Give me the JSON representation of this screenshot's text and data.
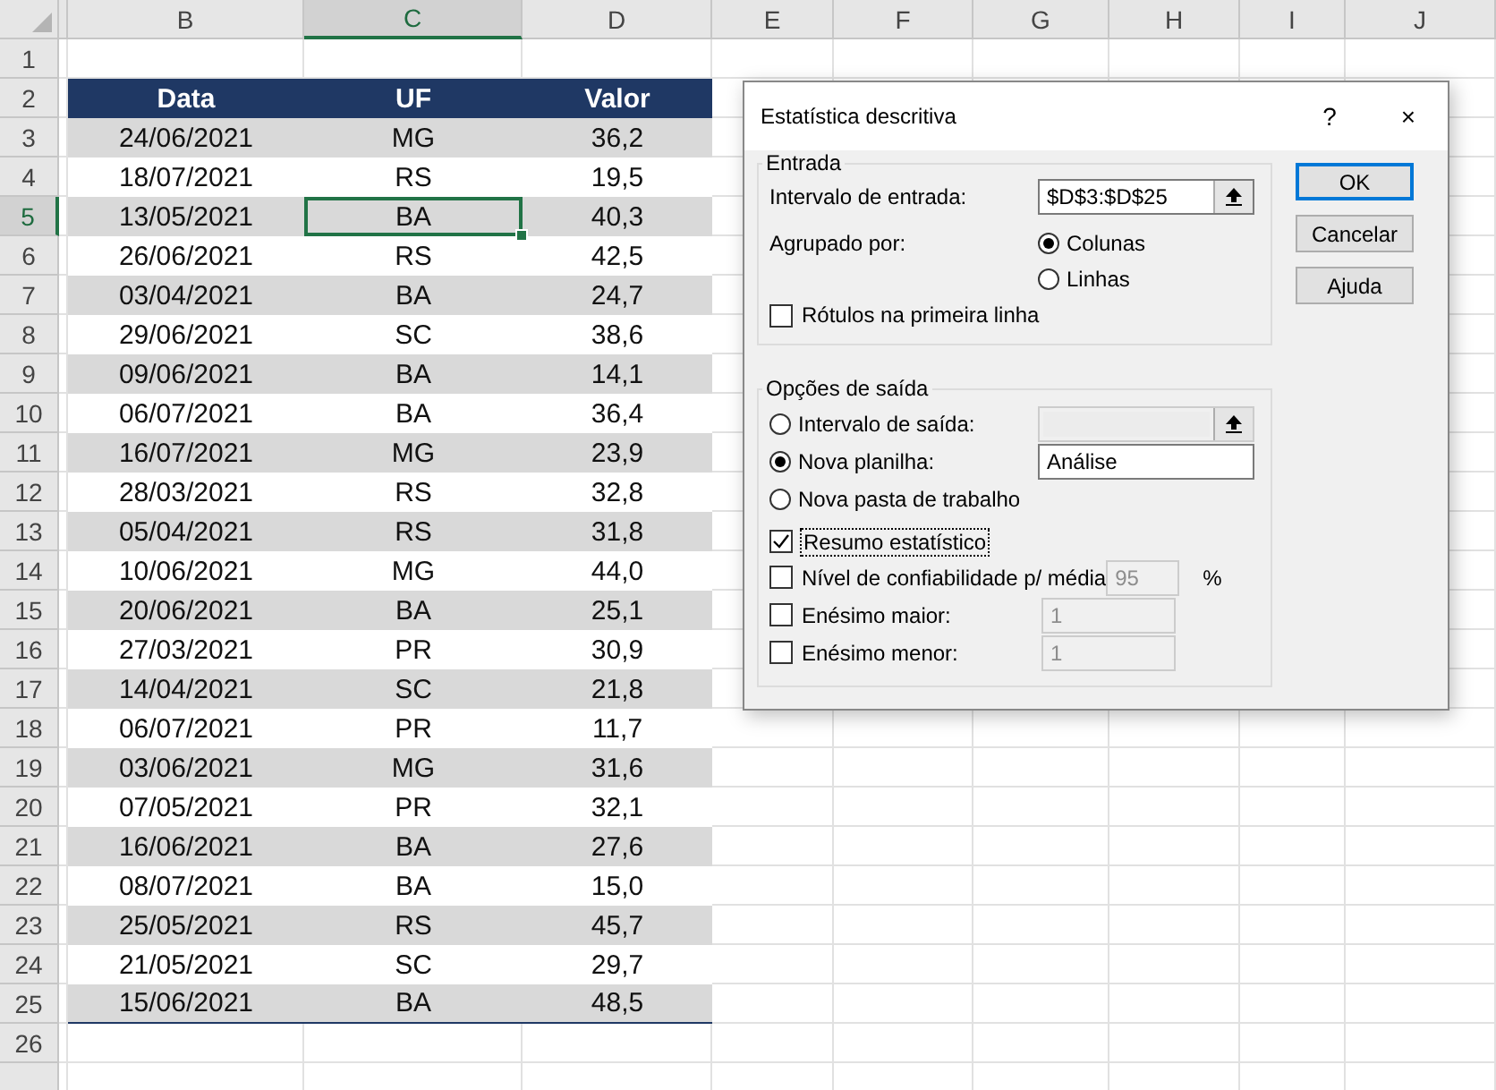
{
  "sheet": {
    "columns": [
      {
        "label": "B",
        "selected": false
      },
      {
        "label": "C",
        "selected": true
      },
      {
        "label": "D",
        "selected": false
      },
      {
        "label": "E",
        "selected": false
      },
      {
        "label": "F",
        "selected": false
      },
      {
        "label": "G",
        "selected": false
      },
      {
        "label": "H",
        "selected": false
      },
      {
        "label": "I",
        "selected": false
      },
      {
        "label": "J",
        "selected": false
      }
    ],
    "rows": [
      {
        "label": "1",
        "selected": false
      },
      {
        "label": "2",
        "selected": false
      },
      {
        "label": "3",
        "selected": false
      },
      {
        "label": "4",
        "selected": false
      },
      {
        "label": "5",
        "selected": true
      },
      {
        "label": "6",
        "selected": false
      },
      {
        "label": "7",
        "selected": false
      },
      {
        "label": "8",
        "selected": false
      },
      {
        "label": "9",
        "selected": false
      },
      {
        "label": "10",
        "selected": false
      },
      {
        "label": "11",
        "selected": false
      },
      {
        "label": "12",
        "selected": false
      },
      {
        "label": "13",
        "selected": false
      },
      {
        "label": "14",
        "selected": false
      },
      {
        "label": "15",
        "selected": false
      },
      {
        "label": "16",
        "selected": false
      },
      {
        "label": "17",
        "selected": false
      },
      {
        "label": "18",
        "selected": false
      },
      {
        "label": "19",
        "selected": false
      },
      {
        "label": "20",
        "selected": false
      },
      {
        "label": "21",
        "selected": false
      },
      {
        "label": "22",
        "selected": false
      },
      {
        "label": "23",
        "selected": false
      },
      {
        "label": "24",
        "selected": false
      },
      {
        "label": "25",
        "selected": false
      },
      {
        "label": "26",
        "selected": false
      }
    ]
  },
  "table": {
    "columns": [
      "Data",
      "UF",
      "Valor"
    ],
    "rows": [
      {
        "cells": [
          {
            "text": "24/06/2021",
            "selected": false
          },
          {
            "text": "MG",
            "selected": false
          },
          {
            "text": "36,2",
            "selected": false
          }
        ]
      },
      {
        "cells": [
          {
            "text": "18/07/2021",
            "selected": false
          },
          {
            "text": "RS",
            "selected": false
          },
          {
            "text": "19,5",
            "selected": false
          }
        ]
      },
      {
        "cells": [
          {
            "text": "13/05/2021",
            "selected": false
          },
          {
            "text": "BA",
            "selected": true
          },
          {
            "text": "40,3",
            "selected": false
          }
        ]
      },
      {
        "cells": [
          {
            "text": "26/06/2021",
            "selected": false
          },
          {
            "text": "RS",
            "selected": false
          },
          {
            "text": "42,5",
            "selected": false
          }
        ]
      },
      {
        "cells": [
          {
            "text": "03/04/2021",
            "selected": false
          },
          {
            "text": "BA",
            "selected": false
          },
          {
            "text": "24,7",
            "selected": false
          }
        ]
      },
      {
        "cells": [
          {
            "text": "29/06/2021",
            "selected": false
          },
          {
            "text": "SC",
            "selected": false
          },
          {
            "text": "38,6",
            "selected": false
          }
        ]
      },
      {
        "cells": [
          {
            "text": "09/06/2021",
            "selected": false
          },
          {
            "text": "BA",
            "selected": false
          },
          {
            "text": "14,1",
            "selected": false
          }
        ]
      },
      {
        "cells": [
          {
            "text": "06/07/2021",
            "selected": false
          },
          {
            "text": "BA",
            "selected": false
          },
          {
            "text": "36,4",
            "selected": false
          }
        ]
      },
      {
        "cells": [
          {
            "text": "16/07/2021",
            "selected": false
          },
          {
            "text": "MG",
            "selected": false
          },
          {
            "text": "23,9",
            "selected": false
          }
        ]
      },
      {
        "cells": [
          {
            "text": "28/03/2021",
            "selected": false
          },
          {
            "text": "RS",
            "selected": false
          },
          {
            "text": "32,8",
            "selected": false
          }
        ]
      },
      {
        "cells": [
          {
            "text": "05/04/2021",
            "selected": false
          },
          {
            "text": "RS",
            "selected": false
          },
          {
            "text": "31,8",
            "selected": false
          }
        ]
      },
      {
        "cells": [
          {
            "text": "10/06/2021",
            "selected": false
          },
          {
            "text": "MG",
            "selected": false
          },
          {
            "text": "44,0",
            "selected": false
          }
        ]
      },
      {
        "cells": [
          {
            "text": "20/06/2021",
            "selected": false
          },
          {
            "text": "BA",
            "selected": false
          },
          {
            "text": "25,1",
            "selected": false
          }
        ]
      },
      {
        "cells": [
          {
            "text": "27/03/2021",
            "selected": false
          },
          {
            "text": "PR",
            "selected": false
          },
          {
            "text": "30,9",
            "selected": false
          }
        ]
      },
      {
        "cells": [
          {
            "text": "14/04/2021",
            "selected": false
          },
          {
            "text": "SC",
            "selected": false
          },
          {
            "text": "21,8",
            "selected": false
          }
        ]
      },
      {
        "cells": [
          {
            "text": "06/07/2021",
            "selected": false
          },
          {
            "text": "PR",
            "selected": false
          },
          {
            "text": "11,7",
            "selected": false
          }
        ]
      },
      {
        "cells": [
          {
            "text": "03/06/2021",
            "selected": false
          },
          {
            "text": "MG",
            "selected": false
          },
          {
            "text": "31,6",
            "selected": false
          }
        ]
      },
      {
        "cells": [
          {
            "text": "07/05/2021",
            "selected": false
          },
          {
            "text": "PR",
            "selected": false
          },
          {
            "text": "32,1",
            "selected": false
          }
        ]
      },
      {
        "cells": [
          {
            "text": "16/06/2021",
            "selected": false
          },
          {
            "text": "BA",
            "selected": false
          },
          {
            "text": "27,6",
            "selected": false
          }
        ]
      },
      {
        "cells": [
          {
            "text": "08/07/2021",
            "selected": false
          },
          {
            "text": "BA",
            "selected": false
          },
          {
            "text": "15,0",
            "selected": false
          }
        ]
      },
      {
        "cells": [
          {
            "text": "25/05/2021",
            "selected": false
          },
          {
            "text": "RS",
            "selected": false
          },
          {
            "text": "45,7",
            "selected": false
          }
        ]
      },
      {
        "cells": [
          {
            "text": "21/05/2021",
            "selected": false
          },
          {
            "text": "SC",
            "selected": false
          },
          {
            "text": "29,7",
            "selected": false
          }
        ]
      },
      {
        "cells": [
          {
            "text": "15/06/2021",
            "selected": false
          },
          {
            "text": "BA",
            "selected": false
          },
          {
            "text": "48,5",
            "selected": false
          }
        ]
      }
    ]
  },
  "dialog": {
    "title": "Estatística descritiva",
    "help": "?",
    "close": "×",
    "input_group": {
      "legend": "Entrada",
      "range_label": "Intervalo de entrada:",
      "range_value": "$D$3:$D$25",
      "grouped_label": "Agrupado por:",
      "grouping": [
        {
          "label": "Colunas",
          "selected": true
        },
        {
          "label": "Linhas",
          "selected": false
        }
      ],
      "labels_first_row": {
        "label": "Rótulos na primeira linha",
        "checked": false
      }
    },
    "output_group": {
      "legend": "Opções de saída",
      "destinations": [
        {
          "label": "Intervalo de saída:",
          "selected": false,
          "kind": "range"
        },
        {
          "label": "Nova planilha:",
          "selected": true,
          "kind": "text",
          "value": "Análise"
        },
        {
          "label": "Nova pasta de trabalho",
          "selected": false,
          "kind": "none"
        }
      ],
      "options": [
        {
          "label": "Resumo estatístico",
          "checked": true,
          "kind": "plain"
        },
        {
          "label": "Nível de confiabilidade p/ média",
          "checked": false,
          "kind": "percent",
          "value": "95",
          "suffix": "%"
        },
        {
          "label": "Enésimo maior:",
          "checked": false,
          "kind": "number",
          "value": "1"
        },
        {
          "label": "Enésimo menor:",
          "checked": false,
          "kind": "number",
          "value": "1"
        }
      ]
    },
    "buttons": [
      {
        "label": "OK",
        "default": true
      },
      {
        "label": "Cancelar",
        "default": false
      },
      {
        "label": "Ajuda",
        "default": false
      }
    ]
  }
}
